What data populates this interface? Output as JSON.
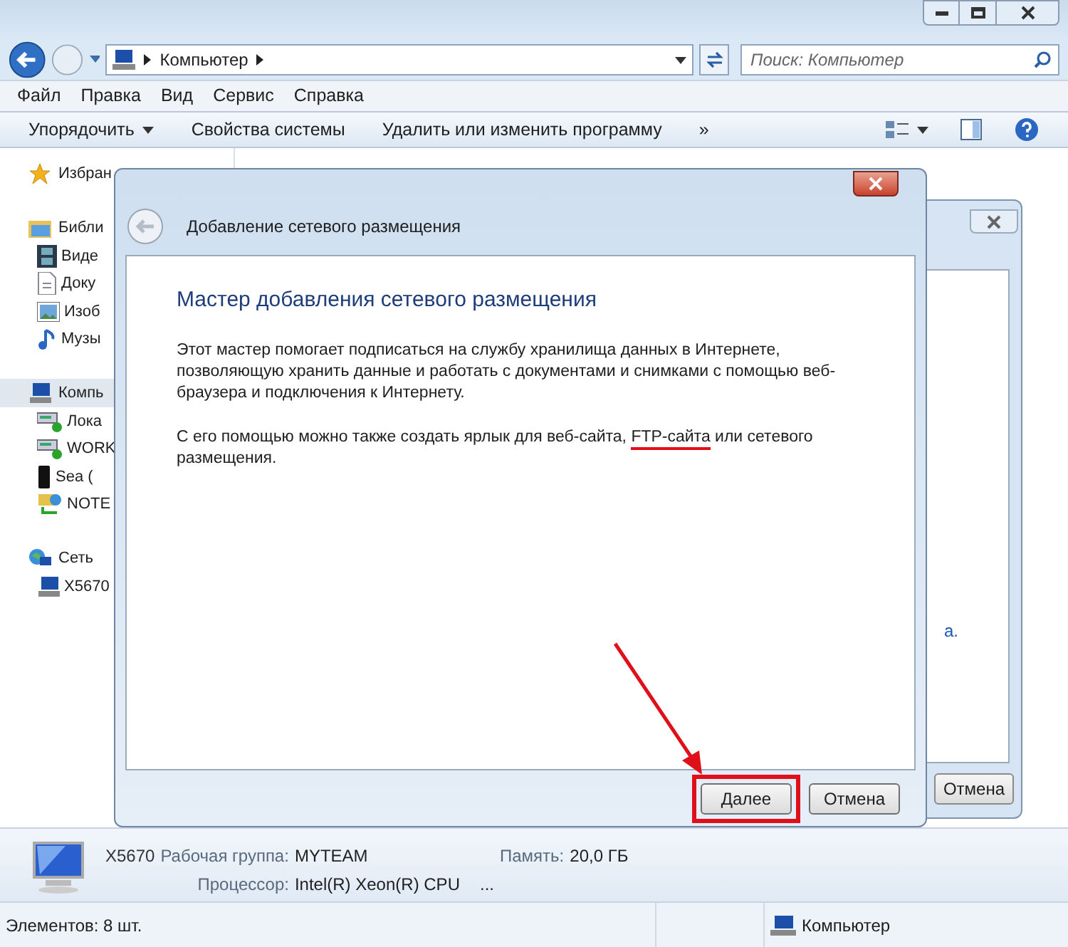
{
  "address_bar": {
    "path": "Компьютер"
  },
  "search": {
    "placeholder": "Поиск: Компьютер"
  },
  "menu": [
    "Файл",
    "Правка",
    "Вид",
    "Сервис",
    "Справка"
  ],
  "toolbar": [
    {
      "label": "Упорядочить",
      "kind": "dropdown"
    },
    {
      "label": "Свойства системы",
      "kind": "plain"
    },
    {
      "label": "Удалить или изменить программу",
      "kind": "plain"
    },
    {
      "label": "»",
      "kind": "plain"
    }
  ],
  "sidebar": [
    {
      "label": "Избран",
      "selected": false
    },
    {
      "label": "Библи",
      "selected": false,
      "children": [
        {
          "label": "Виде",
          "selected": false
        },
        {
          "label": "Доку",
          "selected": false
        },
        {
          "label": "Изоб",
          "selected": false
        },
        {
          "label": "Музы",
          "selected": false
        }
      ]
    },
    {
      "label": "Компь",
      "selected": true,
      "children": [
        {
          "label": "Лока",
          "selected": false
        },
        {
          "label": "WORK",
          "selected": false
        },
        {
          "label": "Sea (",
          "selected": false
        },
        {
          "label": "NOTE",
          "selected": false
        }
      ]
    },
    {
      "label": "Сеть",
      "selected": false,
      "children": [
        {
          "label": "X5670",
          "selected": false
        }
      ]
    }
  ],
  "back_dialog": {
    "link_fragment": "а.",
    "cancel": "Отмена"
  },
  "dialog": {
    "title": "Добавление сетевого размещения",
    "heading": "Мастер добавления сетевого размещения",
    "paragraphs": [
      [
        {
          "text": "Этот мастер помогает подписаться на службу хранилища данных в Интернете, позволяющую хранить данные и работать с документами и снимками с помощью веб-браузера и подключения к Интернету.",
          "underlined": false
        }
      ],
      [
        {
          "text": "С его помощью можно также создать ярлык для веб-сайта, ",
          "underlined": false
        },
        {
          "text": "FTP-сайта",
          "underlined": true
        },
        {
          "text": " или сетевого размещения.",
          "underlined": false
        }
      ]
    ],
    "buttons": [
      {
        "label": "Далее",
        "highlighted": true
      },
      {
        "label": "Отмена",
        "highlighted": false
      }
    ],
    "annotation_arrow": true
  },
  "details": {
    "name": "X5670",
    "fields": [
      {
        "label": "Рабочая группа:",
        "value": "MYTEAM"
      },
      {
        "label": "Память:",
        "value": "20,0 ГБ"
      },
      {
        "label": "Процессор:",
        "value": "Intel(R) Xeon(R) CPU"
      }
    ],
    "more": "..."
  },
  "status_bar": {
    "count": "Элементов: 8 шт.",
    "location": "Компьютер"
  }
}
